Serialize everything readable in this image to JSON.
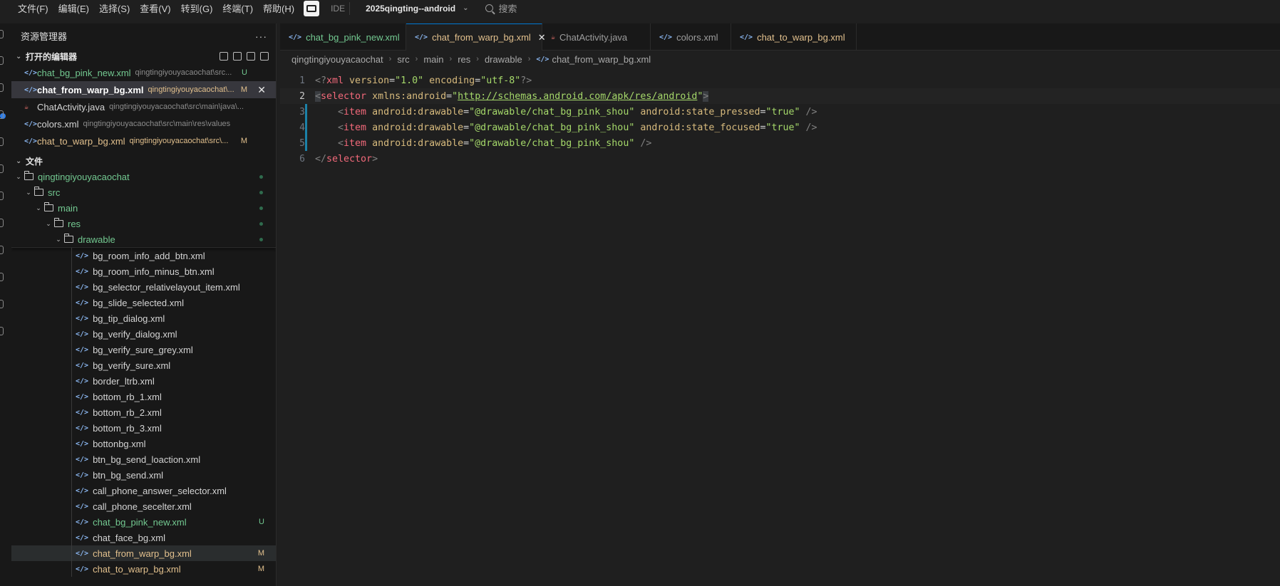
{
  "menu": [
    "文件(F)",
    "编辑(E)",
    "选择(S)",
    "查看(V)",
    "转到(G)",
    "终端(T)",
    "帮助(H)"
  ],
  "ide_label": "IDE",
  "project": "2025qingting--android",
  "search_placeholder": "搜索",
  "sidebar": {
    "title": "资源管理器",
    "open_editors_label": "打开的编辑器",
    "files_label": "文件",
    "open_editors": [
      {
        "name": "chat_bg_pink_new.xml",
        "path": "qingtingiyouyacaochat\\src...",
        "status": "U",
        "type": "xml"
      },
      {
        "name": "chat_from_warp_bg.xml",
        "path": "qingtingiyouyacaochat\\...",
        "status": "M",
        "type": "xml"
      },
      {
        "name": "ChatActivity.java",
        "path": "qingtingiyouyacaochat\\src\\main\\java\\...",
        "status": "",
        "type": "java"
      },
      {
        "name": "colors.xml",
        "path": "qingtingiyouyacaochat\\src\\main\\res\\values",
        "status": "",
        "type": "xml"
      },
      {
        "name": "chat_to_warp_bg.xml",
        "path": "qingtingiyouyacaochat\\src\\...",
        "status": "M",
        "type": "xml"
      }
    ],
    "folders": {
      "root": "qingtingiyouyacaochat",
      "src": "src",
      "main": "main",
      "res": "res",
      "drawable": "drawable"
    },
    "files": [
      {
        "name": "bg_room_info_add_btn.xml",
        "status": ""
      },
      {
        "name": "bg_room_info_minus_btn.xml",
        "status": ""
      },
      {
        "name": "bg_selector_relativelayout_item.xml",
        "status": ""
      },
      {
        "name": "bg_slide_selected.xml",
        "status": ""
      },
      {
        "name": "bg_tip_dialog.xml",
        "status": ""
      },
      {
        "name": "bg_verify_dialog.xml",
        "status": ""
      },
      {
        "name": "bg_verify_sure_grey.xml",
        "status": ""
      },
      {
        "name": "bg_verify_sure.xml",
        "status": ""
      },
      {
        "name": "border_ltrb.xml",
        "status": ""
      },
      {
        "name": "bottom_rb_1.xml",
        "status": ""
      },
      {
        "name": "bottom_rb_2.xml",
        "status": ""
      },
      {
        "name": "bottom_rb_3.xml",
        "status": ""
      },
      {
        "name": "bottonbg.xml",
        "status": ""
      },
      {
        "name": "btn_bg_send_loaction.xml",
        "status": ""
      },
      {
        "name": "btn_bg_send.xml",
        "status": ""
      },
      {
        "name": "call_phone_answer_selector.xml",
        "status": ""
      },
      {
        "name": "call_phone_secelter.xml",
        "status": ""
      },
      {
        "name": "chat_bg_pink_new.xml",
        "status": "U"
      },
      {
        "name": "chat_face_bg.xml",
        "status": ""
      },
      {
        "name": "chat_from_warp_bg.xml",
        "status": "M"
      },
      {
        "name": "chat_to_warp_bg.xml",
        "status": "M"
      }
    ]
  },
  "tabs": [
    {
      "label": "chat_bg_pink_new.xml",
      "type": "xml",
      "status": "U"
    },
    {
      "label": "chat_from_warp_bg.xml",
      "type": "xml",
      "status": "M"
    },
    {
      "label": "ChatActivity.java",
      "type": "java",
      "status": ""
    },
    {
      "label": "colors.xml",
      "type": "xml",
      "status": ""
    },
    {
      "label": "chat_to_warp_bg.xml",
      "type": "xml",
      "status": "M"
    }
  ],
  "breadcrumb": [
    "qingtingiyouyacaochat",
    "src",
    "main",
    "res",
    "drawable",
    "chat_from_warp_bg.xml"
  ],
  "code": {
    "line_numbers": [
      "1",
      "2",
      "3",
      "4",
      "5",
      "6"
    ],
    "l1": {
      "a": "<?",
      "b": "xml",
      "c": " version",
      "d": "=",
      "e": "\"1.0\"",
      "f": " encoding",
      "g": "=",
      "h": "\"utf-8\"",
      "i": "?>"
    },
    "l2": {
      "a": "<",
      "b": "selector",
      "c": " xmlns:android",
      "d": "=",
      "e": "\"",
      "f": "http://schemas.android.com/apk/res/android",
      "g": "\"",
      "h": ">"
    },
    "l3": {
      "a": "    <",
      "b": "item",
      "c": " android:drawable",
      "d": "=",
      "e": "\"@drawable/chat_bg_pink_shou\"",
      "f": " android:state_pressed",
      "g": "=",
      "h": "\"true\"",
      "i": " />"
    },
    "l4": {
      "a": "    <",
      "b": "item",
      "c": " android:drawable",
      "d": "=",
      "e": "\"@drawable/chat_bg_pink_shou\"",
      "f": " android:state_focused",
      "g": "=",
      "h": "\"true\"",
      "i": " />"
    },
    "l5": {
      "a": "    <",
      "b": "item",
      "c": " android:drawable",
      "d": "=",
      "e": "\"@drawable/chat_bg_pink_shou\"",
      "f": " />"
    },
    "l6": {
      "a": "</",
      "b": "selector",
      "c": ">"
    }
  }
}
